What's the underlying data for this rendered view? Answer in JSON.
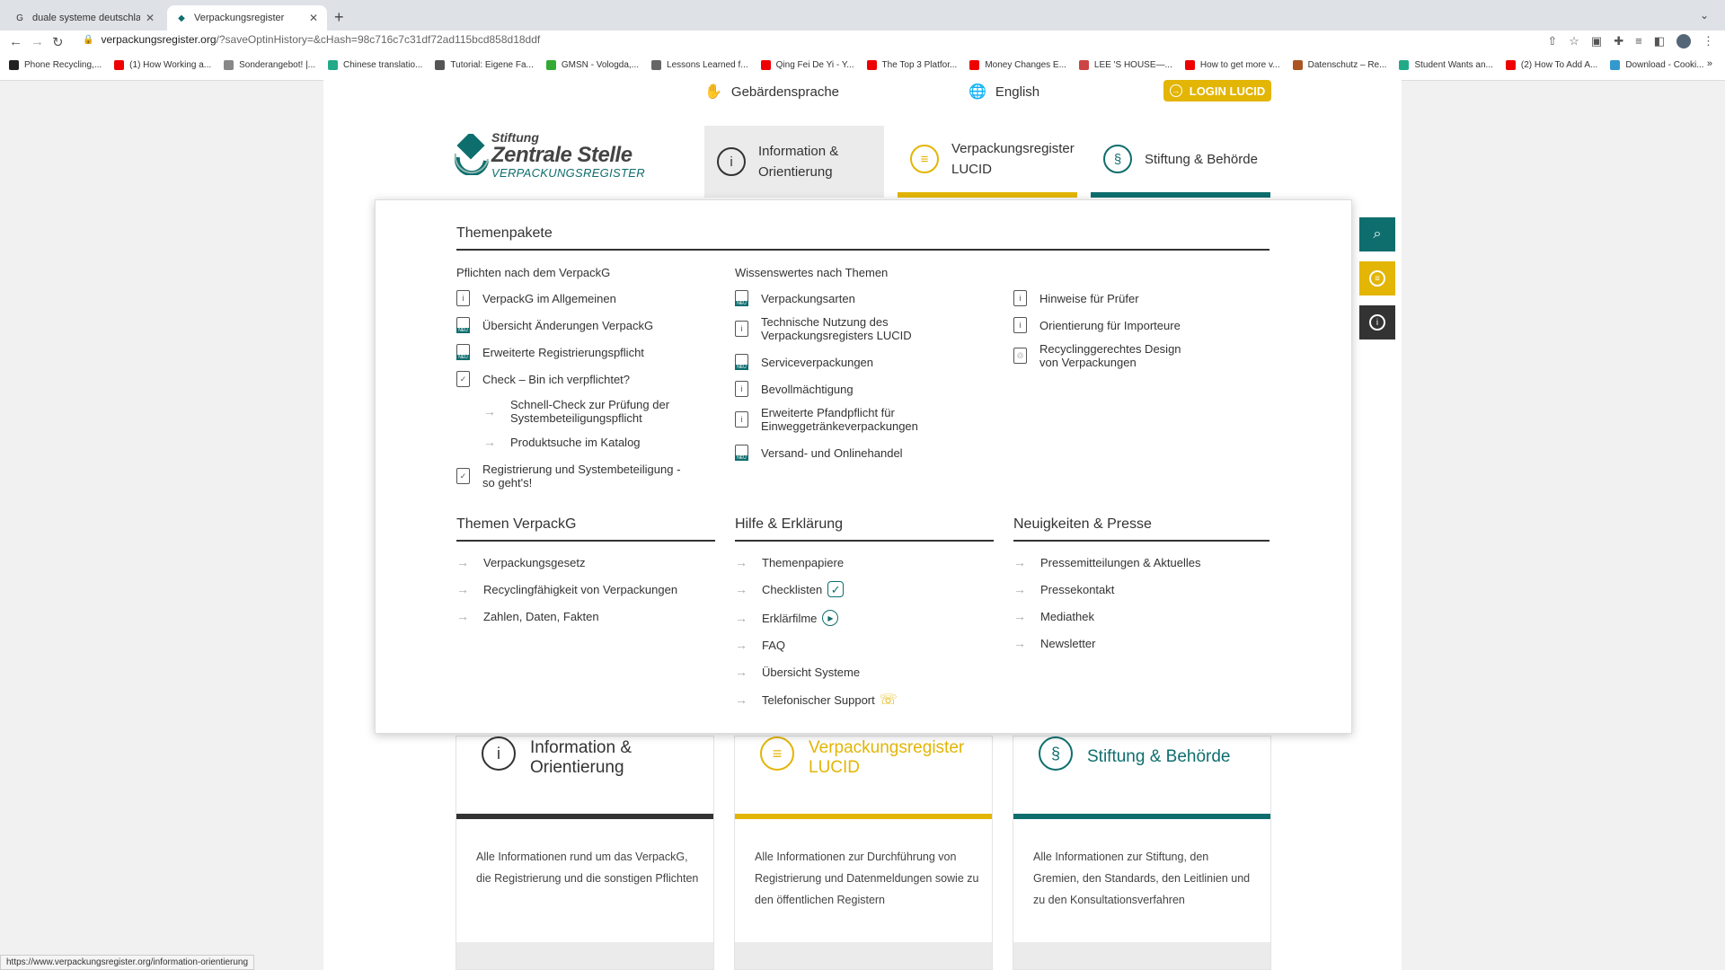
{
  "browser": {
    "tabs": [
      {
        "title": "duale systeme deutschland - G",
        "favicon": "google-icon"
      },
      {
        "title": "Verpackungsregister",
        "favicon": "zsvr-icon"
      }
    ],
    "url_host": "verpackungsregister.org",
    "url_rest": "/?saveOptinHistory=&cHash=98c716c7c31df72ad115bcd858d18ddf",
    "bookmarks": [
      {
        "label": "Phone Recycling,...",
        "color": "#222"
      },
      {
        "label": "(1) How Working a...",
        "color": "#e00"
      },
      {
        "label": "Sonderangebot! |...",
        "color": "#888"
      },
      {
        "label": "Chinese translatio...",
        "color": "#2a8"
      },
      {
        "label": "Tutorial: Eigene Fa...",
        "color": "#555"
      },
      {
        "label": "GMSN - Vologda,...",
        "color": "#3a3"
      },
      {
        "label": "Lessons Learned f...",
        "color": "#666"
      },
      {
        "label": "Qing Fei De Yi - Y...",
        "color": "#e00"
      },
      {
        "label": "The Top 3 Platfor...",
        "color": "#e00"
      },
      {
        "label": "Money Changes E...",
        "color": "#e00"
      },
      {
        "label": "LEE 'S HOUSE—...",
        "color": "#c44"
      },
      {
        "label": "How to get more v...",
        "color": "#e00"
      },
      {
        "label": "Datenschutz – Re...",
        "color": "#a52"
      },
      {
        "label": "Student Wants an...",
        "color": "#2a8"
      },
      {
        "label": "(2) How To Add A...",
        "color": "#e00"
      },
      {
        "label": "Download - Cooki...",
        "color": "#39c"
      }
    ],
    "status_url": "https://www.verpackungsregister.org/information-orientierung"
  },
  "topbar": {
    "sign_language": "Gebärdensprache",
    "language": "English",
    "login": "LOGIN LUCID"
  },
  "logo": {
    "line1": "Stiftung",
    "line2": "Zentrale Stelle",
    "line3": "VERPACKUNGSREGISTER"
  },
  "nav": {
    "tab1": "Information & Orientierung",
    "tab2": "Verpackungsregister LUCID",
    "tab3": "Stiftung & Behörde"
  },
  "menu": {
    "themenpakete": {
      "title": "Themenpakete",
      "col1_title": "Pflichten nach dem VerpackG",
      "col1": [
        {
          "label": "VerpackG im Allgemeinen",
          "icon": "document-info-icon"
        },
        {
          "label": "Übersicht Änderungen VerpackG",
          "icon": "document-new-icon"
        },
        {
          "label": "Erweiterte Registrierungspflicht",
          "icon": "document-new-icon"
        },
        {
          "label": "Check – Bin ich verpflichtet?",
          "icon": "document-check-icon"
        }
      ],
      "col1_sub": [
        "Schnell-Check zur Prüfung der Systembeteiligungspflicht",
        "Produktsuche im Katalog"
      ],
      "col1_last": "Registrierung und Systembeteiligung - so geht's!",
      "col2_title": "Wissenswertes nach Themen",
      "col2": [
        {
          "label": "Verpackungsarten",
          "icon": "document-new-icon"
        },
        {
          "label": "Technische Nutzung des Verpackungsregisters LUCID",
          "icon": "document-info-icon"
        },
        {
          "label": "Serviceverpackungen",
          "icon": "document-new-icon"
        },
        {
          "label": "Bevollmächtigung",
          "icon": "document-info-icon"
        },
        {
          "label": "Erweiterte Pfandpflicht für Einweggetränkeverpackungen",
          "icon": "document-info-icon"
        },
        {
          "label": "Versand- und Onlinehandel",
          "icon": "document-new-icon"
        }
      ],
      "col3": [
        {
          "label": "Hinweise für Prüfer",
          "icon": "document-info-icon"
        },
        {
          "label": "Orientierung für Importeure",
          "icon": "document-info-icon"
        },
        {
          "label": "Recyclinggerechtes Design von Verpackungen",
          "icon": "document-recycle-icon"
        }
      ]
    },
    "themen": {
      "title": "Themen VerpackG",
      "items": [
        "Verpackungsgesetz",
        "Recyclingfähigkeit von Verpackungen",
        "Zahlen, Daten, Fakten"
      ]
    },
    "hilfe": {
      "title": "Hilfe & Erklärung",
      "items": [
        "Themenpapiere",
        "Checklisten",
        "Erklärfilme",
        "FAQ",
        "Übersicht Systeme",
        "Telefonischer Support"
      ]
    },
    "news": {
      "title": "Neuigkeiten & Presse",
      "items": [
        "Pressemitteilungen & Aktuelles",
        "Pressekontakt",
        "Mediathek",
        "Newsletter"
      ]
    }
  },
  "cards": [
    {
      "title": "Information & Orientierung",
      "desc": "Alle Informationen rund um das VerpackG, die Registrierung und die sonstigen Pflichten",
      "color": "#333333"
    },
    {
      "title": "Verpackungsregister LUCID",
      "desc": "Alle Informationen zur Durchführung von Registrierung und Datenmeldungen sowie zu den öffentlichen Registern",
      "color": "#e3b505"
    },
    {
      "title": "Stiftung & Behörde",
      "desc": "Alle Informationen zur Stiftung, den Gremien, den Standards, den Leitlinien und zu den Konsultationsverfahren",
      "color": "#0e6e6e"
    }
  ],
  "colors": {
    "teal": "#0e6e6e",
    "yellow": "#e3b505",
    "dark": "#333333"
  }
}
